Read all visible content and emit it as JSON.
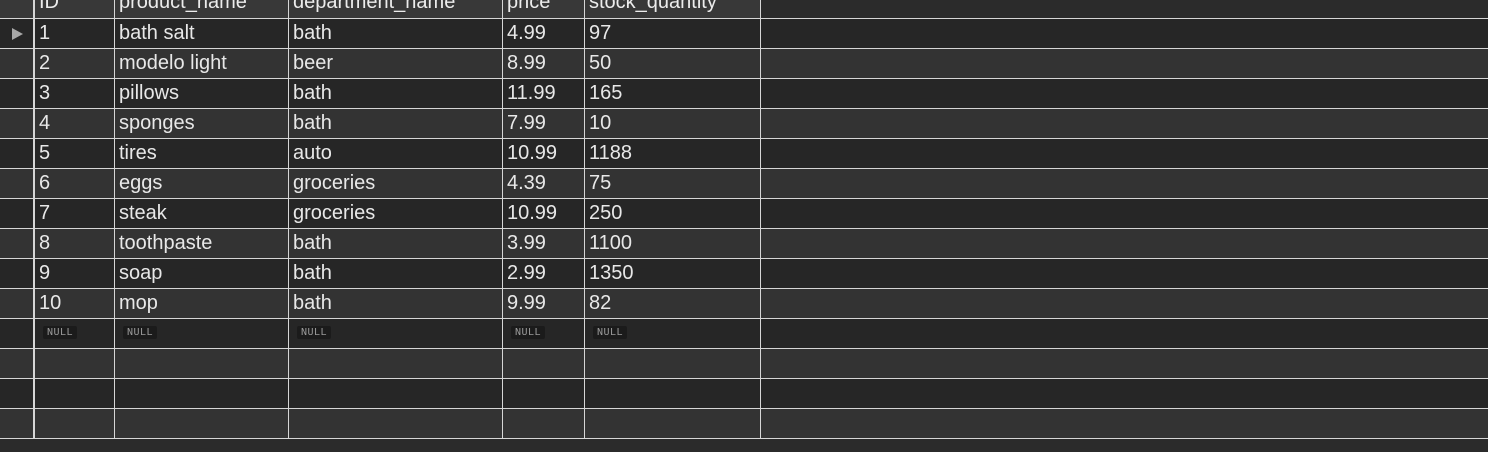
{
  "table": {
    "columns": [
      "ID",
      "product_name",
      "department_name",
      "price",
      "stock_quantity"
    ],
    "rows": [
      [
        "1",
        "bath salt",
        "bath",
        "4.99",
        "97"
      ],
      [
        "2",
        "modelo light",
        "beer",
        "8.99",
        "50"
      ],
      [
        "3",
        "pillows",
        "bath",
        "11.99",
        "165"
      ],
      [
        "4",
        "sponges",
        "bath",
        "7.99",
        "10"
      ],
      [
        "5",
        "tires",
        "auto",
        "10.99",
        "1188"
      ],
      [
        "6",
        "eggs",
        "groceries",
        "4.39",
        "75"
      ],
      [
        "7",
        "steak",
        "groceries",
        "10.99",
        "250"
      ],
      [
        "8",
        "toothpaste",
        "bath",
        "3.99",
        "1100"
      ],
      [
        "9",
        "soap",
        "bath",
        "2.99",
        "1350"
      ],
      [
        "10",
        "mop",
        "bath",
        "9.99",
        "82"
      ]
    ],
    "null_label": "NULL",
    "empty_rows": 3
  },
  "icons": {
    "current_row": "current-row-pointer-icon"
  },
  "colors": {
    "background": "#2b2b2b",
    "row_odd": "#262626",
    "row_even": "#333333",
    "grid_line": "#d6d6d6",
    "text": "#e8e8e8"
  }
}
